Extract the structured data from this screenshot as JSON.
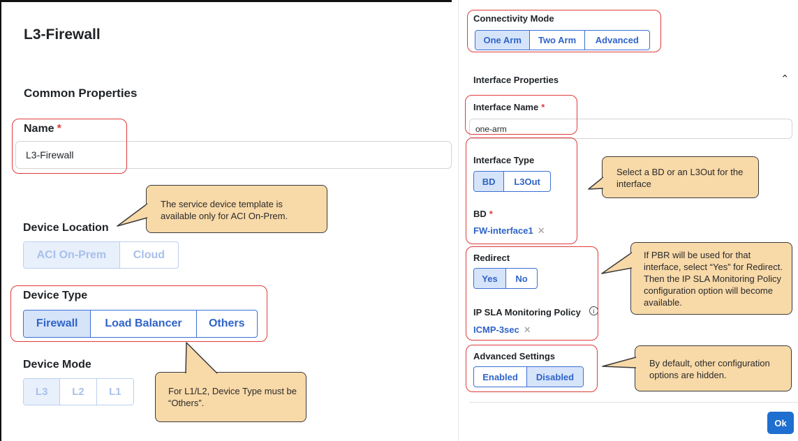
{
  "left": {
    "title": "L3-Firewall",
    "common_properties": "Common Properties",
    "name_label": "Name",
    "required_mark": "*",
    "name_value": "L3-Firewall",
    "device_location_label": "Device Location",
    "device_location_options": [
      "ACI On-Prem",
      "Cloud"
    ],
    "device_type_label": "Device Type",
    "device_type_options": [
      "Firewall",
      "Load Balancer",
      "Others"
    ],
    "device_mode_label": "Device Mode",
    "device_mode_options": [
      "L3",
      "L2",
      "L1"
    ],
    "callout_location": "The service device template is available only for ACI On-Prem.",
    "callout_type": "For L1/L2, Device Type must be “Others”."
  },
  "right": {
    "connectivity_mode_label": "Connectivity Mode",
    "connectivity_options": [
      "One Arm",
      "Two Arm",
      "Advanced"
    ],
    "interface_properties": "Interface Properties",
    "interface_name_label": "Interface Name",
    "interface_name_value": "one-arm",
    "interface_type_label": "Interface Type",
    "interface_type_options": [
      "BD",
      "L3Out"
    ],
    "bd_label": "BD",
    "bd_value": "FW-interface1",
    "redirect_label": "Redirect",
    "redirect_options": [
      "Yes",
      "No"
    ],
    "ip_sla_label": "IP SLA Monitoring Policy",
    "ip_sla_value": "ICMP-3sec",
    "advanced_settings_label": "Advanced Settings",
    "advanced_options": [
      "Enabled",
      "Disabled"
    ],
    "ok_label": "Ok",
    "callout_interface": "Select a BD or an L3Out for the interface",
    "callout_redirect": "If PBR will be used for that interface, select “Yes” for Redirect. Then the IP SLA Monitoring Policy configuration option will  become available.",
    "callout_advanced": "By default, other configuration options are hidden."
  },
  "colors": {
    "accent": "#2f63c9",
    "highlight": "#e03a3a",
    "callout": "#f8d9a8",
    "ok": "#1e6fcf"
  }
}
